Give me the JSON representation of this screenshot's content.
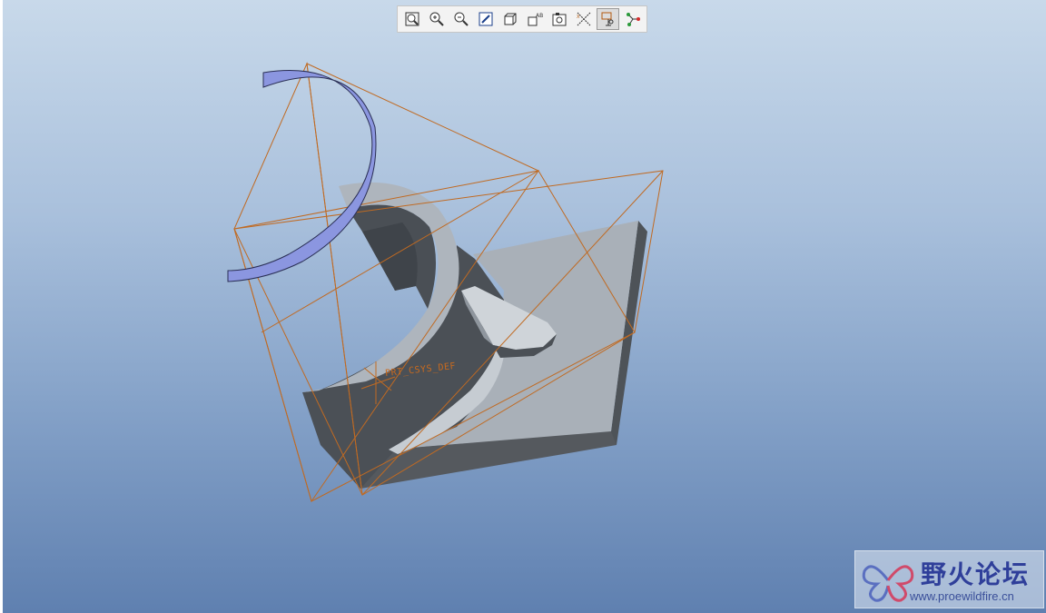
{
  "toolbar": {
    "buttons": [
      {
        "icon": "refit-icon"
      },
      {
        "icon": "zoom-in-icon"
      },
      {
        "icon": "zoom-out-icon"
      },
      {
        "icon": "repaint-icon"
      },
      {
        "icon": "orient-icon"
      },
      {
        "icon": "saved-views-icon"
      },
      {
        "icon": "layers-icon"
      },
      {
        "icon": "datum-axes-icon"
      },
      {
        "icon": "datum-planes-icon"
      },
      {
        "icon": "datum-points-icon"
      }
    ],
    "active_index": 8
  },
  "model": {
    "csys_label": "PRT_CSYS_DEF"
  },
  "watermark": {
    "title": "野火论坛",
    "url": "www.proewildfire.cn"
  },
  "colors": {
    "background_top": "#c8d9ea",
    "background_bottom": "#5f80b0",
    "datum_plane": "#c06a22",
    "sketch_curve": "#8b96e0",
    "part_dark": "#4d5359",
    "part_light": "#a7aeb6"
  }
}
